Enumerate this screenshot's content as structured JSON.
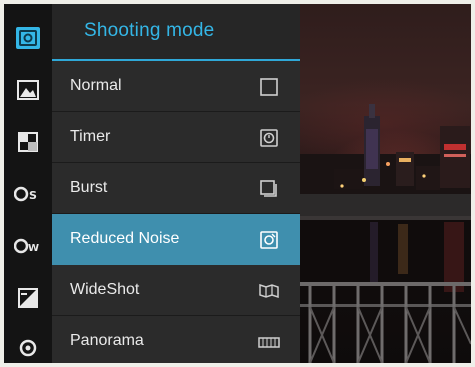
{
  "panel": {
    "title": "Shooting mode",
    "accent_color": "#34b6e6",
    "selected_color": "#3f8fae",
    "items": [
      {
        "label": "Normal",
        "icon": "square-frame-icon",
        "selected": false
      },
      {
        "label": "Timer",
        "icon": "timer-icon",
        "selected": false
      },
      {
        "label": "Burst",
        "icon": "burst-stack-icon",
        "selected": false
      },
      {
        "label": "Reduced Noise",
        "icon": "reduced-noise-icon",
        "selected": true
      },
      {
        "label": "WideShot",
        "icon": "wideshot-icon",
        "selected": false
      },
      {
        "label": "Panorama",
        "icon": "panorama-icon",
        "selected": false
      }
    ]
  },
  "rail": {
    "items": [
      {
        "icon": "shooting-mode-icon",
        "active": true
      },
      {
        "icon": "scene-icon",
        "active": false
      },
      {
        "icon": "effects-icon",
        "active": false
      },
      {
        "icon": "iso-icon",
        "active": false
      },
      {
        "icon": "white-balance-icon",
        "active": false
      },
      {
        "icon": "exposure-icon",
        "active": false
      },
      {
        "icon": "settings-icon",
        "active": false
      }
    ]
  }
}
